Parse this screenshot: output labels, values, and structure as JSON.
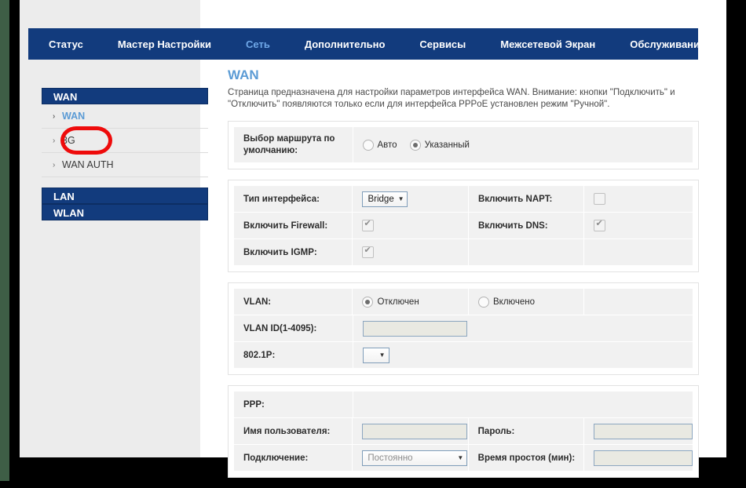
{
  "nav": {
    "items": [
      {
        "label": "Статус",
        "active": false
      },
      {
        "label": "Мастер Настройки",
        "active": false
      },
      {
        "label": "Сеть",
        "active": true
      },
      {
        "label": "Дополнительно",
        "active": false
      },
      {
        "label": "Сервисы",
        "active": false
      },
      {
        "label": "Межсетевой Экран",
        "active": false
      },
      {
        "label": "Обслуживание",
        "active": false
      }
    ]
  },
  "sidebar": {
    "wan_header": "WAN",
    "links": [
      {
        "label": "WAN",
        "active": true
      },
      {
        "label": "3G",
        "active": false
      },
      {
        "label": "WAN AUTH",
        "active": false
      }
    ],
    "lan_header": "LAN",
    "wlan_header": "WLAN",
    "arrow": "›"
  },
  "annotation": {
    "target": "3G",
    "color": "#ee0b0b"
  },
  "page": {
    "title": "WAN",
    "description": "Страница предназначена для настройки параметров интерфейса WAN. Внимание: кнопки \"Подключить\" и \"Отключить\" появляются только если для интерфейса PPPoE установлен режим \"Ручной\"."
  },
  "panel_route": {
    "label": "Выбор маршрута по умолчанию:",
    "label_line1": "Выбор маршрута по",
    "label_line2": "умолчанию:",
    "options": [
      {
        "label": "Авто",
        "selected": false
      },
      {
        "label": "Указанный",
        "selected": true
      }
    ]
  },
  "panel_interface": {
    "iface_type_label": "Тип интерфейса:",
    "iface_type_value": "Bridge",
    "napt_label": "Включить NAPT:",
    "napt_checked": false,
    "firewall_label": "Включить Firewall:",
    "firewall_checked": true,
    "dns_label": "Включить DNS:",
    "dns_checked": true,
    "igmp_label": "Включить IGMP:",
    "igmp_checked": true
  },
  "panel_vlan": {
    "vlan_label": "VLAN:",
    "vlan_options": [
      {
        "label": "Отключен",
        "selected": true
      },
      {
        "label": "Включено",
        "selected": false
      }
    ],
    "vlan_id_label": "VLAN ID(1-4095):",
    "vlan_id_value": "",
    "dot1p_label": "802.1P:",
    "dot1p_value": ""
  },
  "panel_ppp": {
    "ppp_label": "PPP:",
    "username_label": "Имя пользователя:",
    "username_value": "",
    "password_label": "Пароль:",
    "password_value": "",
    "connection_label": "Подключение:",
    "connection_value": "Постоянно",
    "idle_label": "Время простоя (мин):",
    "idle_value": ""
  },
  "icons": {
    "caret_down": "▼"
  }
}
